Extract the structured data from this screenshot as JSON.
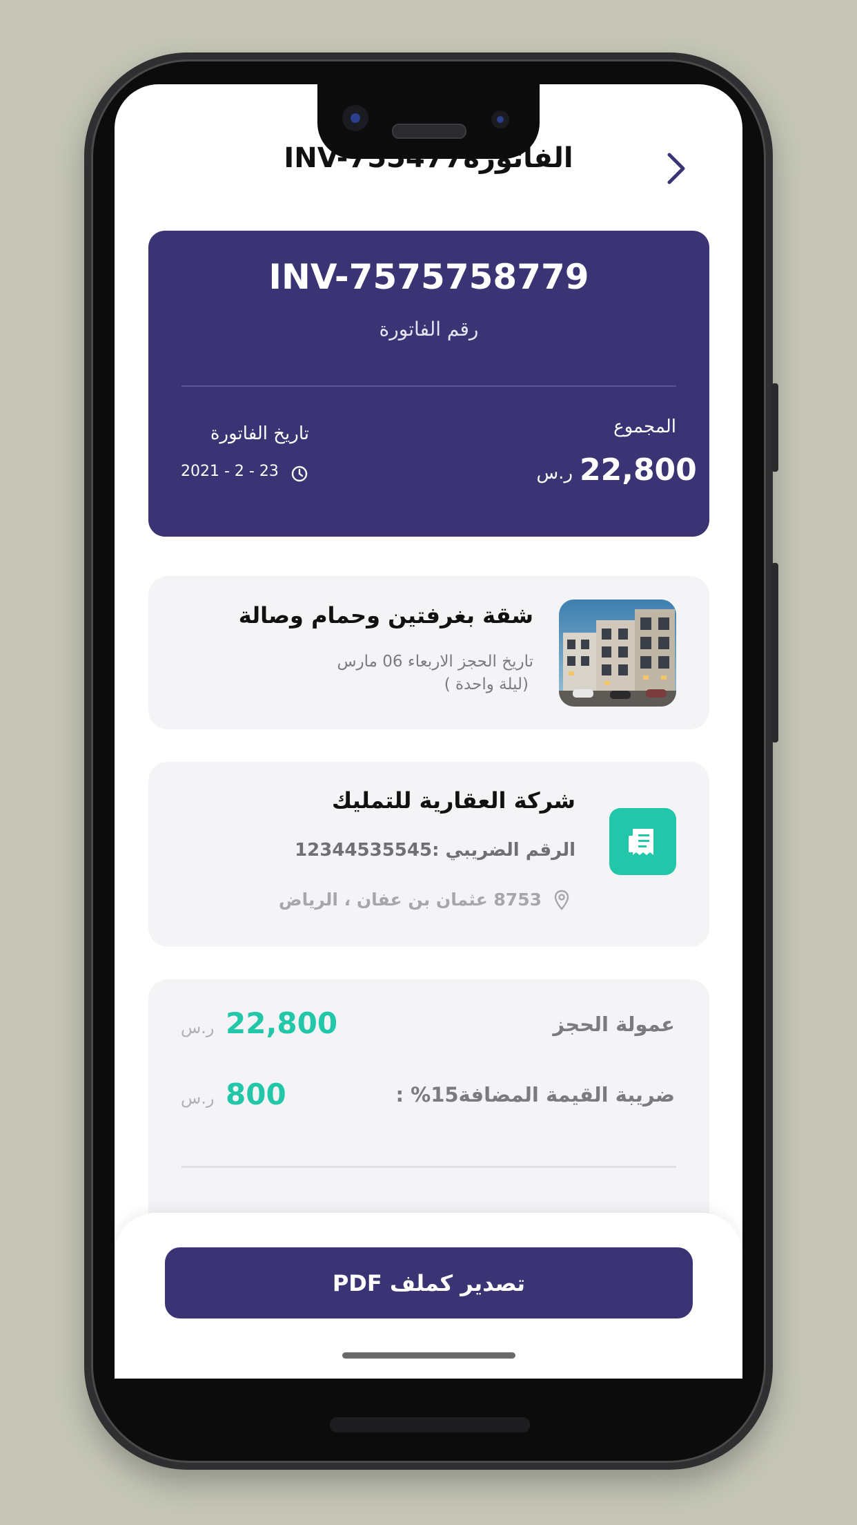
{
  "header": {
    "title": "الفاتورةINV-755477"
  },
  "invoice": {
    "number": "INV-7575758779",
    "number_label": "رقم الفاتورة",
    "total_label": "المجموع",
    "total_value": "22,800",
    "currency": "ر.س",
    "date_label": "تاريخ الفاتورة",
    "date_value": "2021 - 2 - 23"
  },
  "property": {
    "title": "شقة بغرفتين وحمام وصالة",
    "booking_date": "تاريخ الحجز الاربعاء 06  مارس",
    "nights": "(ليلة واحدة )"
  },
  "company": {
    "name": "شركة العقارية للتمليك",
    "tax_number": "الرقم الضريبي :12344535545",
    "address": "8753 عثمان بن عفان ، الرياض"
  },
  "amounts": {
    "booking_fee_label": "عمولة الحجز",
    "booking_fee_value": "22,800",
    "vat_label": "ضريبة القيمة المضافة15% :",
    "vat_value": "800",
    "currency": "ر.س"
  },
  "actions": {
    "export_pdf_label": "تصدير كملف PDF"
  },
  "colors": {
    "primary": "#3a3474",
    "accent": "#21c7a8",
    "background": "#c4c5b6"
  },
  "icons": {
    "back": "chevron-right-icon",
    "clock": "clock-icon",
    "receipt": "receipt-icon",
    "location": "location-pin-icon"
  }
}
